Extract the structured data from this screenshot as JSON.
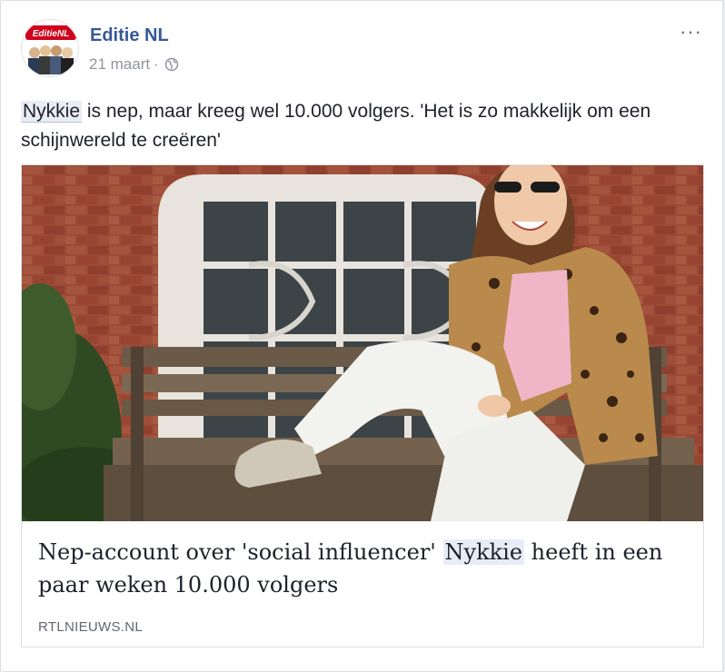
{
  "post": {
    "page_name": "Editie NL",
    "avatar_logo_text": "EditieNL",
    "date": "21 maart",
    "separator": "·",
    "more_label": "···",
    "text_mention": "Nykkie",
    "text_rest_line1": " is nep, maar kreeg wel 10.000 volgers. 'Het is zo makkelijk om een",
    "text_rest_line2": "schijnwereld te creëren'"
  },
  "link_preview": {
    "title_before": "Nep-account over 'social influencer' ",
    "title_mention": "Nykkie",
    "title_after": " heeft in een paar weken 10.000 volgers",
    "source": "RTLNIEUWS.NL"
  },
  "colors": {
    "link_blue": "#365899",
    "meta_gray": "#90949c",
    "brick": "#a0432f",
    "logo_red": "#d0021b"
  }
}
